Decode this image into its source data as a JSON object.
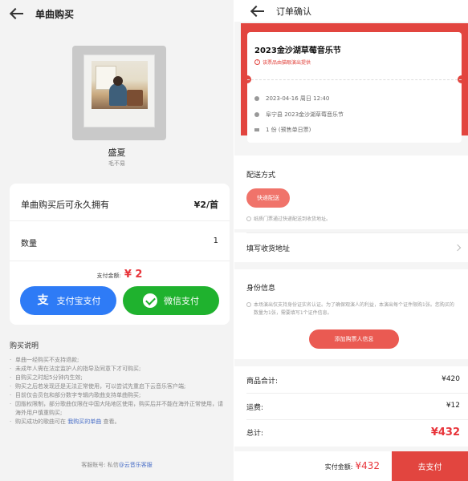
{
  "left": {
    "title": "单曲购买",
    "song": "盛夏",
    "artist": "毛不易",
    "purchase_text": "单曲购买后可永久拥有",
    "price": "¥2/首",
    "quantity_label": "数量",
    "quantity": "1",
    "pay_amount_label": "支付金额:",
    "pay_amount": "¥ 2",
    "alipay_label": "支付宝支付",
    "wechat_label": "微信支付",
    "notes_title": "购买说明",
    "notes": [
      "单曲一经购买不支持退款;",
      "未成年人需在法定监护人的指导及同意下才可购买;",
      "自购买之时起5分钟内生效;",
      "购买之后若发现还是无法正常使用，可以尝试先重启下云音乐客户端;",
      "目前仅会员包和部分数字专辑内歌曲支持单曲购买;",
      "因版权限制，部分歌曲仅限在中国大陆地区使用，购买后并不能在海外正常使用，请海外用户慎重购买;"
    ],
    "last_note_prefix": "购买成功的歌曲可在",
    "last_note_link": "我购买的单曲",
    "last_note_suffix": "查看。",
    "service_prefix": "客服账号: 私信",
    "service_link": "@云音乐客服"
  },
  "right": {
    "title": "订单确认",
    "event_title": "2023金沙湖草莓音乐节",
    "warning": "该票品由猫眼演出提供",
    "date": "2023-04-16 周日 12:40",
    "venue": "阜宁县 2023金沙湖草莓音乐节",
    "ticket_count": "1 份 (预售单日票)",
    "delivery_title": "配送方式",
    "delivery_option": "快递配送",
    "delivery_note": "纸质门票通过快递配送到收货地址。",
    "address_label": "填写收货地址",
    "identity_title": "身份信息",
    "identity_note": "本场演出仅支持身份证实名认证。为了确保观演人的利益，本演出每个证件限购1张。您购买的数量为1张，需要填写1个证件信息。",
    "add_person_button": "添加购票人信息",
    "subtotal_label": "商品合计:",
    "subtotal": "¥420",
    "shipping_label": "运费:",
    "shipping": "¥12",
    "total_label": "总计:",
    "total": "¥432",
    "actual_label": "实付金额:",
    "actual": "¥432",
    "pay_button": "去支付"
  },
  "colors": {
    "accent_red": "#e2453f",
    "alipay_blue": "#2e7bf6",
    "wechat_green": "#1fb22e",
    "link_blue": "#4a6fc7"
  }
}
